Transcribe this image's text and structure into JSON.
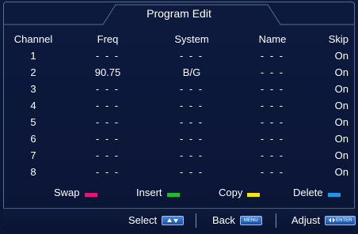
{
  "title": "Program Edit",
  "columns": {
    "channel": "Channel",
    "freq": "Freq",
    "system": "System",
    "name": "Name",
    "skip": "Skip"
  },
  "rows": [
    {
      "channel": "1",
      "freq": "- - -",
      "system": "- - -",
      "name": "- - -",
      "skip": "On"
    },
    {
      "channel": "2",
      "freq": "90.75",
      "system": "B/G",
      "name": "- - -",
      "skip": "On"
    },
    {
      "channel": "3",
      "freq": "- - -",
      "system": "- - -",
      "name": "- - -",
      "skip": "On"
    },
    {
      "channel": "4",
      "freq": "- - -",
      "system": "- - -",
      "name": "- - -",
      "skip": "On"
    },
    {
      "channel": "5",
      "freq": "- - -",
      "system": "- - -",
      "name": "- - -",
      "skip": "On"
    },
    {
      "channel": "6",
      "freq": "- - -",
      "system": "- - -",
      "name": "- - -",
      "skip": "On"
    },
    {
      "channel": "7",
      "freq": "- - -",
      "system": "- - -",
      "name": "- - -",
      "skip": "On"
    },
    {
      "channel": "8",
      "freq": "- - -",
      "system": "- - -",
      "name": "- - -",
      "skip": "On"
    }
  ],
  "actions": {
    "swap": {
      "label": "Swap",
      "color": "#e4157a"
    },
    "insert": {
      "label": "Insert",
      "color": "#1fb83a"
    },
    "copy": {
      "label": "Copy",
      "color": "#f2e60e"
    },
    "delete": {
      "label": "Delete",
      "color": "#1f97e6"
    }
  },
  "footer": {
    "select": "Select",
    "back": "Back",
    "back_key": "MENU",
    "adjust": "Adjust",
    "adjust_key": "ENTER"
  },
  "colors": {
    "background": "#0b1536",
    "border": "#5a6c92"
  }
}
